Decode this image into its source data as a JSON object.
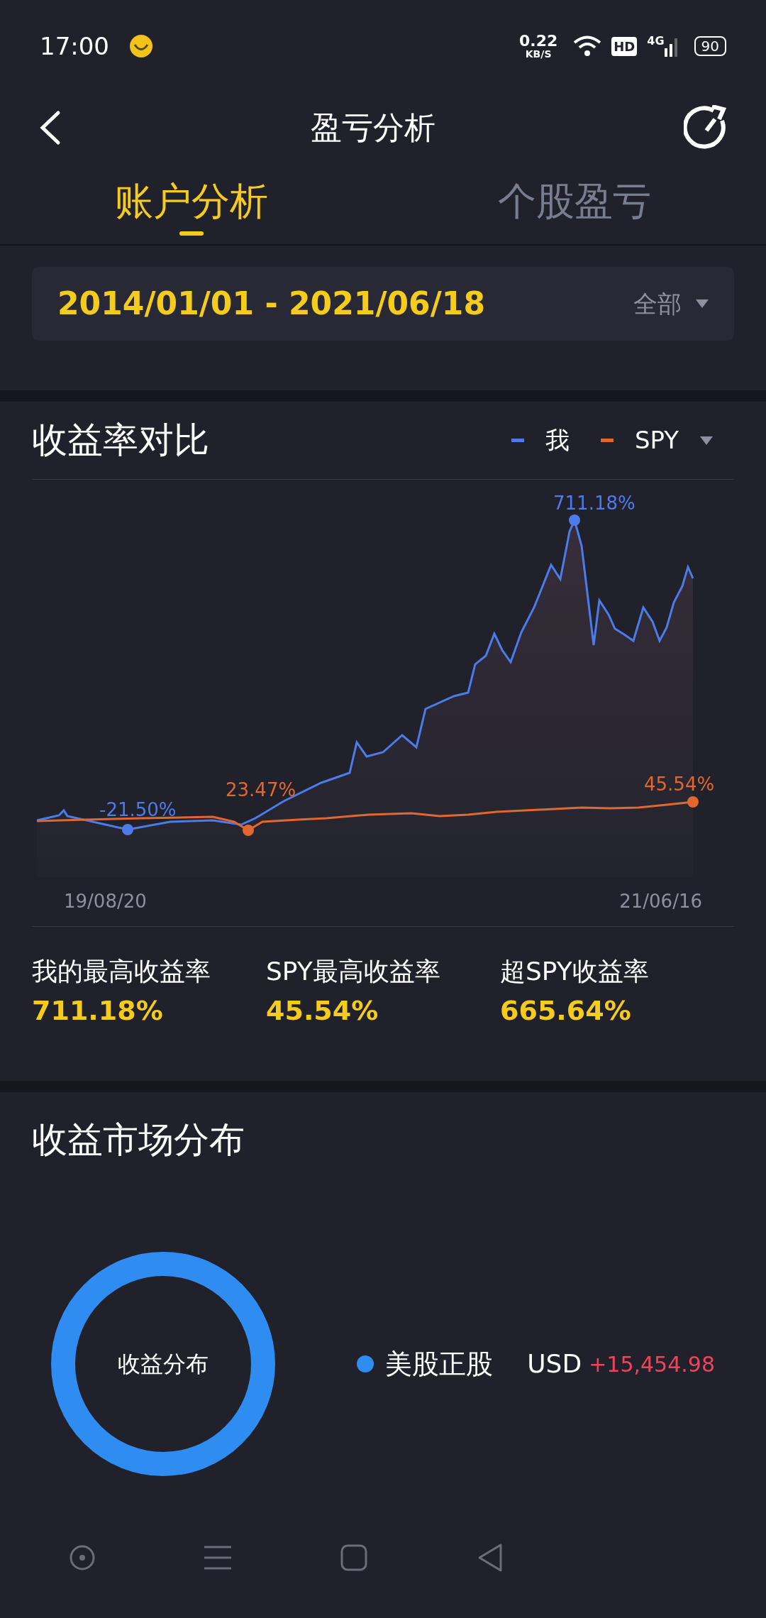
{
  "status_bar": {
    "time": "17:00",
    "speed_value": "0.22",
    "speed_unit": "KB/S",
    "hd": "HD",
    "network": "4G",
    "battery": "90"
  },
  "header": {
    "title": "盈亏分析"
  },
  "tabs": [
    {
      "label": "账户分析",
      "selected": true
    },
    {
      "label": "个股盈亏",
      "selected": false
    }
  ],
  "date_range": {
    "value": "2014/01/01 - 2021/06/18",
    "filter": "全部"
  },
  "return_comparison": {
    "title": "收益率对比",
    "legend": [
      {
        "label": "我",
        "color": "#4c7bea"
      },
      {
        "label": "SPY",
        "color": "#e0672f"
      }
    ],
    "annotations": {
      "my_max": "711.18%",
      "my_min": "-21.50%",
      "spy_min": "23.47%",
      "spy_max": "45.54%"
    },
    "x_start": "19/08/20",
    "x_end": "21/06/16",
    "stats": [
      {
        "label": "我的最高收益率",
        "value": "711.18%"
      },
      {
        "label": "SPY最高收益率",
        "value": "45.54%"
      },
      {
        "label": "超SPY收益率",
        "value": "665.64%"
      }
    ]
  },
  "market_distribution": {
    "title": "收益市场分布",
    "donut_label": "收益分布",
    "items": [
      {
        "name": "美股正股",
        "currency": "USD",
        "amount": "+15,454.98",
        "color": "#2f8cf0"
      }
    ]
  }
}
